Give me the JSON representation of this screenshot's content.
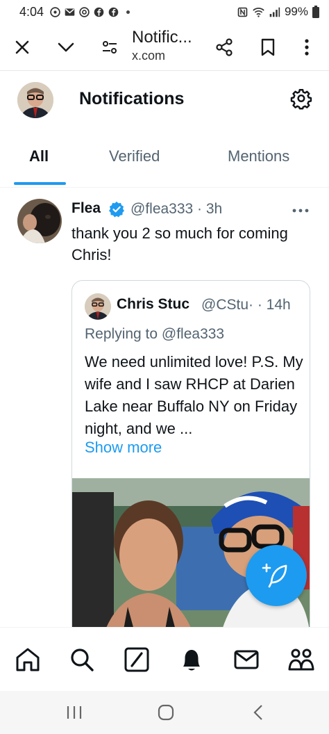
{
  "status_bar": {
    "time": "4:04",
    "battery": "99%",
    "icons": [
      "whatsapp-icon",
      "gmail-icon",
      "chrome-icon",
      "facebook-icon",
      "facebook-icon",
      "nfc-icon",
      "wifi-icon",
      "signal-icon",
      "battery-icon"
    ]
  },
  "browser": {
    "title": "Notific...",
    "domain": "x.com",
    "icons": [
      "close-icon",
      "chevron-down-icon",
      "site-settings-icon",
      "share-icon",
      "bookmark-icon",
      "more-vert-icon"
    ]
  },
  "header": {
    "title": "Notifications"
  },
  "tabs": [
    {
      "label": "All",
      "active": true
    },
    {
      "label": "Verified",
      "active": false
    },
    {
      "label": "Mentions",
      "active": false
    }
  ],
  "tweet": {
    "name": "Flea",
    "handle_time": "@flea333 · 3h",
    "text": "thank you 2 so much for coming Chris!",
    "quote": {
      "name": "Chris Stuc",
      "handle_time": "@CStu· · 14h",
      "replying": "Replying to @flea333",
      "text": "We need unlimited love! P.S. My wife and I saw RHCP at Darien Lake near Buffalo NY on Friday night, and we ...",
      "show_more": "Show more"
    }
  },
  "colors": {
    "accent": "#1d9bf0",
    "text_primary": "#0f1419",
    "text_secondary": "#536471"
  },
  "bottom_nav": [
    "home-icon",
    "search-icon",
    "grok-icon",
    "notifications-icon",
    "messages-icon",
    "communities-icon"
  ]
}
